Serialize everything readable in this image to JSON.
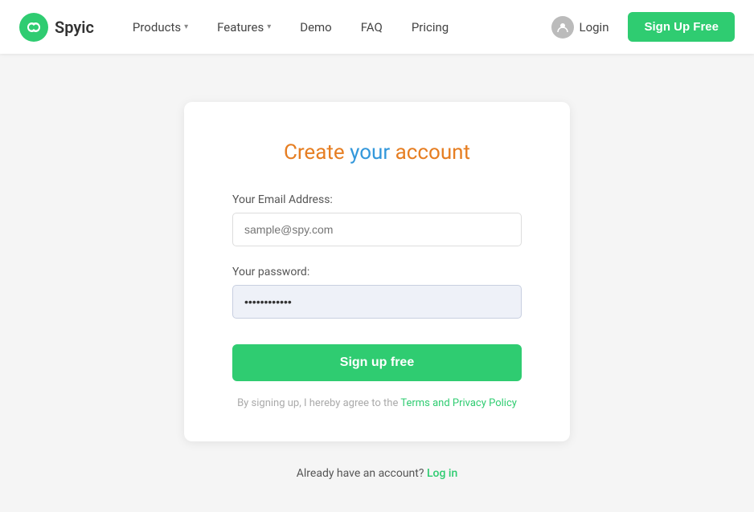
{
  "brand": {
    "name": "Spyic"
  },
  "nav": {
    "items": [
      {
        "label": "Products",
        "has_dropdown": true
      },
      {
        "label": "Features",
        "has_dropdown": true
      },
      {
        "label": "Demo",
        "has_dropdown": false
      },
      {
        "label": "FAQ",
        "has_dropdown": false
      },
      {
        "label": "Pricing",
        "has_dropdown": false
      }
    ],
    "login_label": "Login",
    "signup_label": "Sign Up Free"
  },
  "form": {
    "title_part1": "Create ",
    "title_part2": "your",
    "title_part3": " account",
    "email_label": "Your Email Address:",
    "email_placeholder": "sample@spy.com",
    "email_value": "",
    "password_label": "Your password:",
    "password_placeholder": "",
    "password_value": "············",
    "submit_label": "Sign up free",
    "terms_prefix": "By signing up, I hereby agree to the ",
    "terms_link_label": "Terms and Privacy Policy",
    "already_account": "Already have an account?",
    "login_link_label": "Log in"
  }
}
